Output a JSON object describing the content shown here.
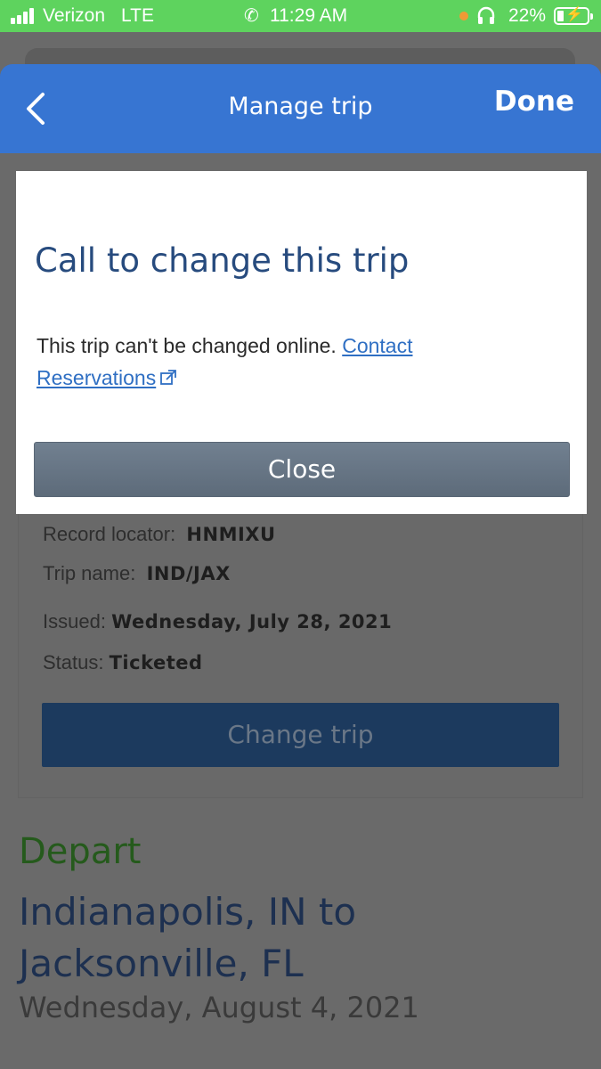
{
  "status_bar": {
    "carrier": "Verizon",
    "network": "LTE",
    "time": "11:29 AM",
    "battery": "22%",
    "battery_level": 0.22,
    "icons": [
      "signal-icon",
      "phone-icon",
      "mic-dot-icon",
      "headphones-icon",
      "battery-icon"
    ],
    "bg_color": "#5ed35e"
  },
  "nav": {
    "title": "Manage trip",
    "done_label": "Done",
    "color": "#3775d2"
  },
  "modal": {
    "title": "Call to change this trip",
    "message": "This trip can't be changed online.",
    "link_text": "Contact Reservations",
    "close_label": "Close"
  },
  "trip": {
    "record_locator_label": "Record locator:",
    "record_locator": "HNMIXU",
    "trip_name_label": "Trip name:",
    "trip_name": "IND/JAX",
    "issued_label": "Issued:",
    "issued": "Wednesday, July 28, 2021",
    "status_label": "Status:",
    "status": "Ticketed",
    "change_trip_label": "Change trip"
  },
  "depart": {
    "label": "Depart",
    "route": "Indianapolis, IN to Jacksonville, FL",
    "date": "Wednesday, August 4, 2021"
  }
}
